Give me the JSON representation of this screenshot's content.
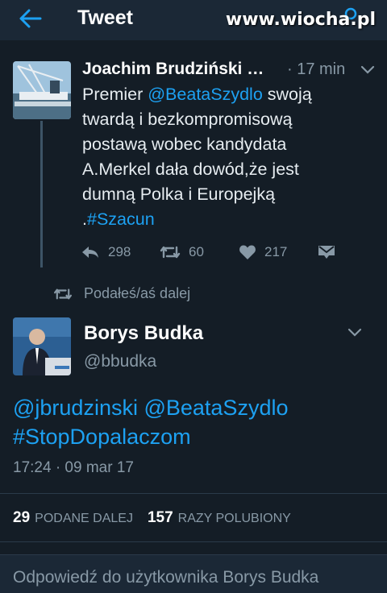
{
  "header": {
    "title": "Tweet",
    "watermark": "www.wiocha.pl"
  },
  "retweeted_tweet": {
    "author_name": "Joachim Brudziński …",
    "time": "· 17 min",
    "text_parts": [
      {
        "text": "Premier ",
        "type": "text"
      },
      {
        "text": "@BeataSzydlo",
        "type": "link"
      },
      {
        "text": " swoją twardą i bezkompromisową postawą wobec kandydata A.Merkel dała dowód,że jest dumną Polka i Europejką .",
        "type": "text"
      },
      {
        "text": "#Szacun",
        "type": "link"
      }
    ],
    "reply_count": "",
    "retweet_count": "298",
    "retweet_count2": "60",
    "like_count": "217"
  },
  "retweet_note": "Podałeś/aś dalej",
  "main_tweet": {
    "author_name": "Borys Budka",
    "handle": "@bbudka",
    "text_line1": "@jbrudzinski @BeataSzydlo",
    "text_line2": "#StopDopalaczom",
    "date": "17:24 · 09 mar 17",
    "retweets_count": "29",
    "retweets_label": "PODANE DALEJ",
    "likes_count": "157",
    "likes_label": "RAZY POLUBIONY"
  },
  "reply_box": {
    "placeholder": "Odpowiedź do użytkownika Borys Budka"
  },
  "colors": {
    "background": "#141d26",
    "link": "#1da1f2",
    "muted": "#8899a6"
  }
}
